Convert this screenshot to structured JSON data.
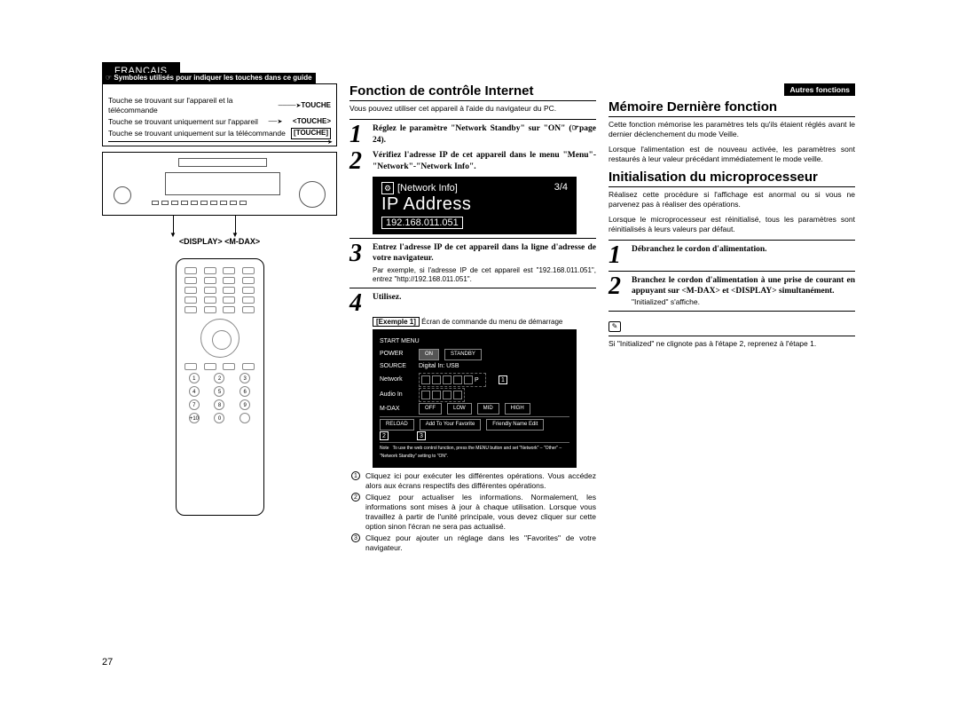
{
  "lang_tab": "FRANÇAIS",
  "symbols": {
    "header": "Symboles utilisés pour indiquer les touches dans ce guide",
    "row1_text": "Touche se trouvant sur l'appareil et la télécommande",
    "row1_btn": "TOUCHE",
    "row2_text": "Touche se trouvant uniquement sur l'appareil",
    "row2_btn": "<TOUCHE>",
    "row3_text": "Touche se trouvant uniquement sur la télécommande",
    "row3_btn": "[TOUCHE]"
  },
  "display_mdax": "<DISPLAY> <M-DAX>",
  "mid": {
    "title": "Fonction de contrôle Internet",
    "intro": "Vous pouvez utiliser cet appareil à l'aide du navigateur du PC.",
    "step1": "Réglez le paramètre \"Network Standby\" sur \"ON\" (☞page 24).",
    "step2": "Vérifiez l'adresse IP de cet appareil dans le menu \"Menu\"-\"Network\"-\"Network Info\".",
    "ipbox": {
      "label": "[Network Info]",
      "count": "3/4",
      "title": "IP Address",
      "ip": "192.168.011.051"
    },
    "step3": "Entrez l'adresse IP de cet appareil dans la ligne d'adresse de votre navigateur.",
    "step3_note": "Par exemple, si l'adresse IP de cet appareil est \"192.168.011.051\", entrez \"http://192.168.011.051\".",
    "step4": "Utilisez.",
    "example_tag": "[Exemple 1]",
    "example_text": "Écran de commande du menu de démarrage",
    "mockui": {
      "title": "START MENU",
      "power": "POWER",
      "on": "ON",
      "standby": "STANDBY",
      "source": "SOURCE",
      "source_val": "Digital In: USB",
      "network": "Network",
      "audioin": "Audio In",
      "mdax": "M-DAX",
      "off": "OFF",
      "low": "LOW",
      "mid_l": "MID",
      "high": "HIGH",
      "reload": "RELOAD",
      "addfav": "Add To Your Favorite",
      "friendly": "Friendly Name Edit",
      "note_label": "Note",
      "note_text": "To use the web control function, press the MENU button and set \"Network\" – \"Other\" – \"Network Standby\" setting to \"ON\"."
    },
    "annot1": "Cliquez ici pour exécuter les différentes opérations. Vous accédez alors aux écrans respectifs des différentes opérations.",
    "annot2": "Cliquez pour actualiser les informations. Normalement, les informations sont mises à jour à chaque utilisation. Lorsque vous travaillez à partir de l'unité principale, vous devez cliquer sur cette option sinon l'écran ne sera pas actualisé.",
    "annot3": "Cliquez pour ajouter un réglage dans les \"Favorites\" de votre navigateur."
  },
  "right": {
    "pill": "Autres fonctions",
    "title1": "Mémoire Dernière fonction",
    "t1_p1": "Cette fonction mémorise les paramètres tels qu'ils étaient réglés avant le dernier déclenchement du mode Veille.",
    "t1_p2": "Lorsque l'alimentation est de nouveau activée, les paramètres sont restaurés à leur valeur précédant immédiatement le mode veille.",
    "title2": "Initialisation du microprocesseur",
    "t2_p1": "Réalisez cette procédure si l'affichage est anormal ou si vous ne parvenez pas à réaliser des opérations.",
    "t2_p2": "Lorsque le microprocesseur est réinitialisé, tous les paramètres sont réinitialisés à leurs valeurs par défaut.",
    "step1": "Débranchez le cordon d'alimentation.",
    "step2": "Branchez le cordon d'alimentation à une prise de courant en appuyant sur <M-DAX> et <DISPLAY> simultanément.",
    "step2_note": "\"Initialized\" s'affiche.",
    "footnote": "Si \"Initialized\" ne clignote pas à l'étape 2, reprenez à l'étape 1."
  },
  "page_number": "27"
}
